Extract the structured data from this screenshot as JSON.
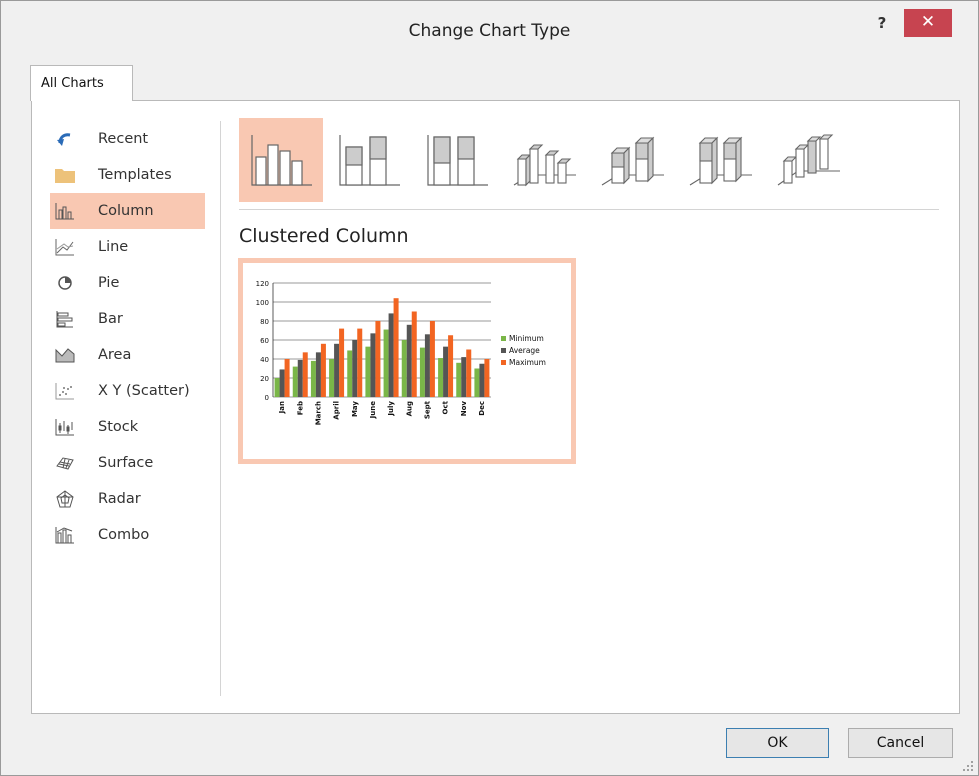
{
  "window": {
    "title": "Change Chart Type",
    "help": "?",
    "close": "✕"
  },
  "tabs": [
    {
      "label": "All Charts"
    }
  ],
  "categories": [
    {
      "label": "Recent",
      "icon": "recent-icon"
    },
    {
      "label": "Templates",
      "icon": "folder-icon"
    },
    {
      "label": "Column",
      "icon": "column-chart-icon",
      "selected": true
    },
    {
      "label": "Line",
      "icon": "line-chart-icon"
    },
    {
      "label": "Pie",
      "icon": "pie-chart-icon"
    },
    {
      "label": "Bar",
      "icon": "bar-chart-icon"
    },
    {
      "label": "Area",
      "icon": "area-chart-icon"
    },
    {
      "label": "X Y (Scatter)",
      "icon": "scatter-chart-icon"
    },
    {
      "label": "Stock",
      "icon": "stock-chart-icon"
    },
    {
      "label": "Surface",
      "icon": "surface-chart-icon"
    },
    {
      "label": "Radar",
      "icon": "radar-chart-icon"
    },
    {
      "label": "Combo",
      "icon": "combo-chart-icon"
    }
  ],
  "subtypes": [
    {
      "name": "clustered-column",
      "selected": true
    },
    {
      "name": "stacked-column"
    },
    {
      "name": "100-stacked-column"
    },
    {
      "name": "3d-clustered-column"
    },
    {
      "name": "3d-stacked-column"
    },
    {
      "name": "3d-100-stacked-column"
    },
    {
      "name": "3d-column"
    }
  ],
  "selected_subtype_title": "Clustered Column",
  "buttons": {
    "ok": "OK",
    "cancel": "Cancel"
  },
  "colors": {
    "accent_selected": "#f9c8b2",
    "close": "#c74450"
  },
  "chart_data": {
    "type": "bar",
    "categories": [
      "Jan",
      "Feb",
      "March",
      "April",
      "May",
      "June",
      "July",
      "Aug",
      "Sept",
      "Oct",
      "Nov",
      "Dec"
    ],
    "series": [
      {
        "name": "Minimum",
        "color": "#7ab648",
        "values": [
          20,
          32,
          38,
          40,
          49,
          53,
          71,
          60,
          52,
          41,
          36,
          30
        ]
      },
      {
        "name": "Average",
        "color": "#555555",
        "values": [
          29,
          39,
          47,
          56,
          60,
          67,
          88,
          76,
          66,
          53,
          42,
          35
        ]
      },
      {
        "name": "Maximum",
        "color": "#f26522",
        "values": [
          40,
          47,
          56,
          72,
          72,
          80,
          104,
          90,
          80,
          65,
          50,
          40
        ]
      }
    ],
    "yticks": [
      "120",
      "100",
      "80",
      "60",
      "40",
      "20",
      "0"
    ],
    "ylim": [
      0,
      120
    ],
    "legend_position": "right",
    "grid": true
  }
}
